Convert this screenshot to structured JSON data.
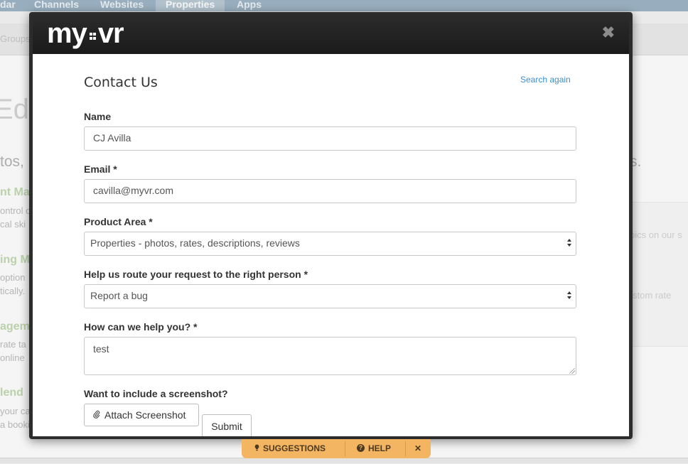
{
  "background": {
    "nav": [
      "dar",
      "Channels",
      "Websites",
      "Properties",
      "Apps"
    ],
    "active_nav": "Properties",
    "breadcrumb": "Groups",
    "title_fragment": "Edi",
    "lead_fragment": "tos,",
    "lead_fragment_right": "s.",
    "sections": [
      {
        "heading": "nt Ma",
        "lines": [
          "ontrol o",
          "cal ski"
        ]
      },
      {
        "heading": "ing M",
        "lines": [
          "option",
          "tically."
        ]
      },
      {
        "heading": "agem",
        "lines": [
          "rate ta",
          "online"
        ]
      },
      {
        "heading": "lend",
        "lines": [
          "your ca",
          "a booki"
        ]
      }
    ],
    "panel_lines": [
      "pics on our s",
      "stom rate"
    ]
  },
  "modal": {
    "logo_left": "my",
    "logo_right": "vr",
    "close_glyph": "✖",
    "title": "Contact Us",
    "search_again": "Search again",
    "name": {
      "label": "Name",
      "value": "CJ Avilla"
    },
    "email": {
      "label": "Email *",
      "value": "cavilla@myvr.com"
    },
    "product_area": {
      "label": "Product Area *",
      "value": "Properties - photos, rates, descriptions, reviews"
    },
    "route": {
      "label": "Help us route your request to the right person *",
      "value": "Report a bug"
    },
    "help_text": {
      "label": "How can we help you? *",
      "value": "test"
    },
    "screenshot": {
      "label": "Want to include a screenshot?",
      "button": "Attach Screenshot"
    },
    "submit": "Submit"
  },
  "helpbar": {
    "suggestions": "SUGGESTIONS",
    "help": "HELP",
    "close": "✕"
  },
  "icons": {
    "close": "close-icon",
    "paperclip": "paperclip-icon",
    "lightbulb": "lightbulb-icon",
    "question": "question-circle-icon",
    "select": "select-arrows-icon"
  },
  "colors": {
    "link": "#3f8fc9",
    "helpbar": "#f3b562",
    "modal_frame": "#2c2c2c"
  }
}
